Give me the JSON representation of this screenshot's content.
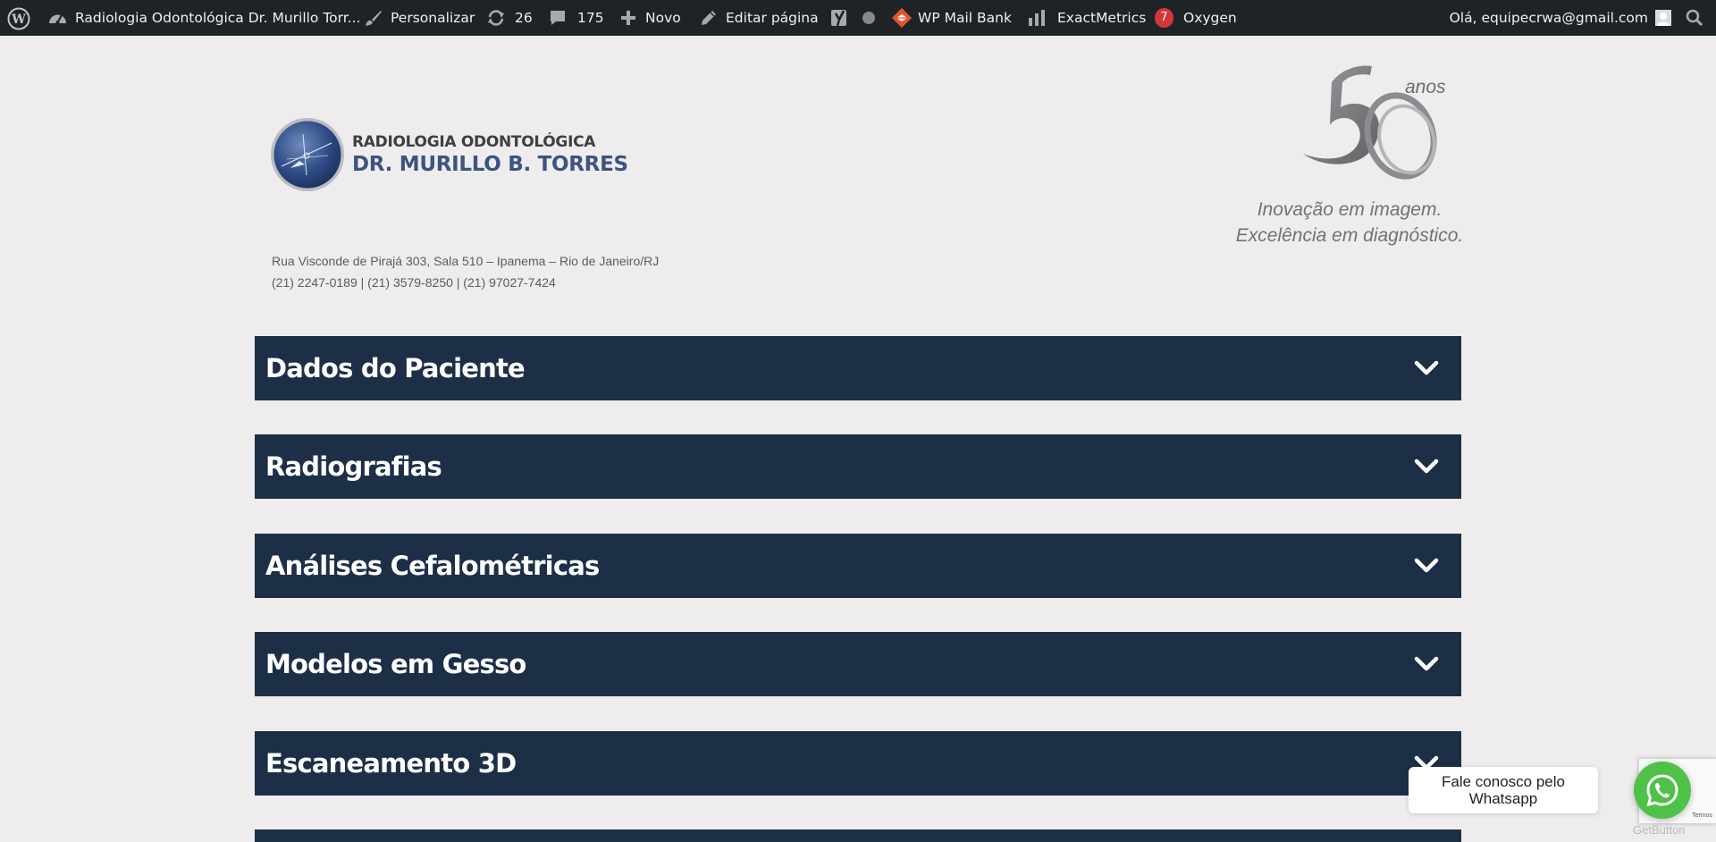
{
  "adminbar": {
    "site_name": "Radiologia Odontológica Dr. Murillo Torr...",
    "customize": "Personalizar",
    "updates_count": "26",
    "comments_count": "175",
    "new": "Novo",
    "edit_page": "Editar página",
    "mail_bank": "WP Mail Bank",
    "exactmetrics": "ExactMetrics",
    "exactmetrics_badge": "7",
    "oxygen": "Oxygen",
    "greeting": "Olá, equipecrwa@gmail.com"
  },
  "header": {
    "logo_line1": "RADIOLOGIA ODONTOLÓGICA",
    "logo_line2": "DR. MURILLO B. TORRES",
    "anniversary_number": "50",
    "anniversary_word": "anos",
    "slogan_line1": "Inovação em imagem.",
    "slogan_line2": "Excelência em diagnóstico.",
    "address": "Rua Visconde de Pirajá 303, Sala 510 – Ipanema – Rio de Janeiro/RJ",
    "phones": "(21) 2247-0189 | (21) 3579-8250 | (21) 97027-7424"
  },
  "accordion": [
    {
      "title": "Dados do Paciente"
    },
    {
      "title": "Radiografias"
    },
    {
      "title": "Análises Cefalométricas"
    },
    {
      "title": "Modelos em Gesso"
    },
    {
      "title": "Escaneamento 3D"
    }
  ],
  "whatsapp": {
    "bubble_text": "Fale conosco pelo Whatsapp",
    "getbutton_label": "GetButton"
  },
  "recaptcha": {
    "terms": "Termos"
  },
  "colors": {
    "adminbar_bg": "#1d2327",
    "accordion_bg": "#1d2f47",
    "page_bg": "#eeeced",
    "whatsapp_green": "#4dc247",
    "badge_red": "#d63638"
  }
}
